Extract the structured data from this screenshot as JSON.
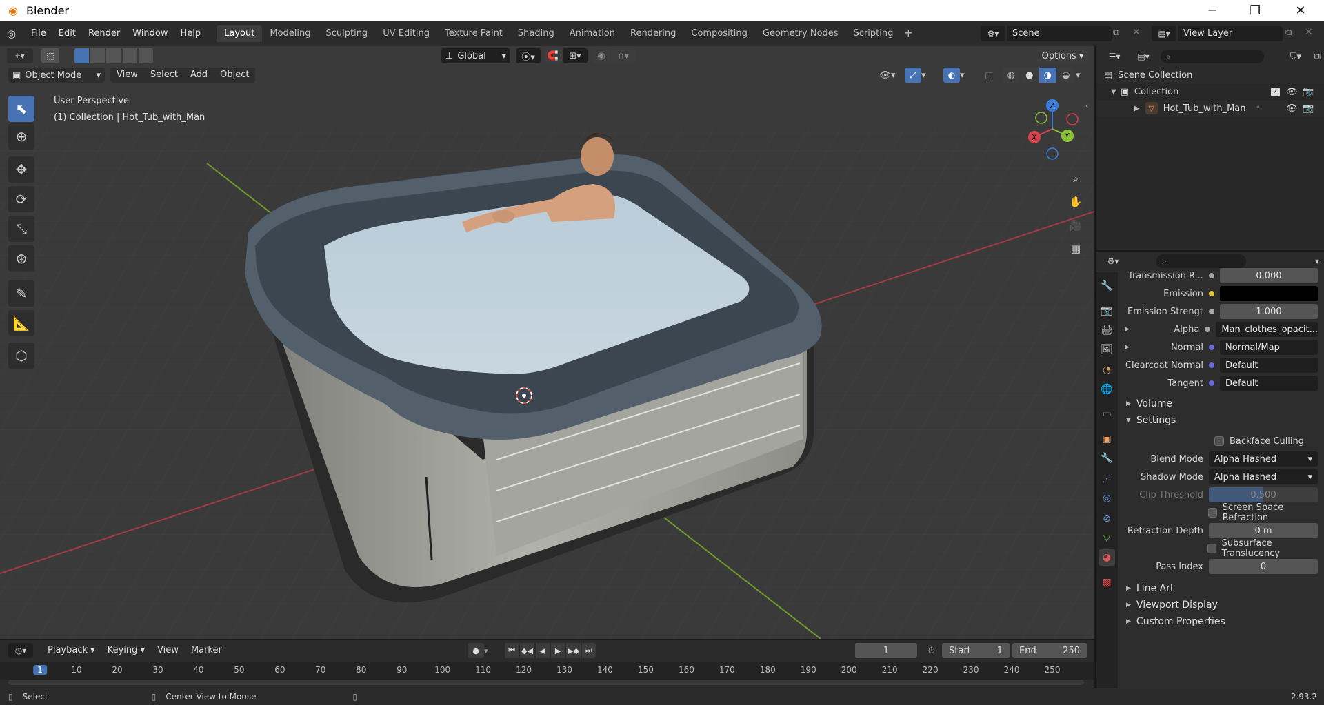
{
  "window": {
    "title": "Blender",
    "minimize": "─",
    "maximize": "❐",
    "close": "✕"
  },
  "menu": [
    "File",
    "Edit",
    "Render",
    "Window",
    "Help"
  ],
  "workspaces": [
    "Layout",
    "Modeling",
    "Sculpting",
    "UV Editing",
    "Texture Paint",
    "Shading",
    "Animation",
    "Rendering",
    "Compositing",
    "Geometry Nodes",
    "Scripting"
  ],
  "active_workspace": "Layout",
  "scene": {
    "name": "Scene",
    "view_layer": "View Layer"
  },
  "viewport": {
    "orientation": "Global",
    "options_label": "Options",
    "mode": "Object Mode",
    "header_menus": [
      "View",
      "Select",
      "Add",
      "Object"
    ],
    "perspective_label": "User Perspective",
    "collection_label": "(1) Collection | Hot_Tub_with_Man",
    "gizmo_axes": {
      "x": "X",
      "y": "Y",
      "z": "Z"
    }
  },
  "outliner": {
    "root": "Scene Collection",
    "collection": "Collection",
    "object": "Hot_Tub_with_Man"
  },
  "properties": {
    "rows": [
      {
        "label": "Transmission R...",
        "value": "0.000"
      },
      {
        "label": "Emission",
        "value": ""
      },
      {
        "label": "Emission Strengt",
        "value": "1.000"
      },
      {
        "label": "Alpha",
        "value": "Man_clothes_opacit..."
      },
      {
        "label": "Normal",
        "value": "Normal/Map"
      },
      {
        "label": "Clearcoat Normal",
        "value": "Default"
      },
      {
        "label": "Tangent",
        "value": "Default"
      }
    ],
    "sections": {
      "volume": "Volume",
      "settings": "Settings",
      "line_art": "Line Art",
      "viewport_display": "Viewport Display",
      "custom_properties": "Custom Properties"
    },
    "settings": {
      "backface_culling": "Backface Culling",
      "blend_mode_label": "Blend Mode",
      "blend_mode": "Alpha Hashed",
      "shadow_mode_label": "Shadow Mode",
      "shadow_mode": "Alpha Hashed",
      "clip_threshold_label": "Clip Threshold",
      "clip_threshold": "0.500",
      "screen_space_refraction": "Screen Space Refraction",
      "refraction_depth_label": "Refraction Depth",
      "refraction_depth": "0 m",
      "subsurface_translucency": "Subsurface Translucency",
      "pass_index_label": "Pass Index",
      "pass_index": "0"
    }
  },
  "timeline": {
    "menus": [
      "Playback",
      "Keying",
      "View",
      "Marker"
    ],
    "current_frame": "1",
    "start_label": "Start",
    "start": "1",
    "end_label": "End",
    "end": "250",
    "ruler": [
      "1",
      "10",
      "20",
      "30",
      "40",
      "50",
      "60",
      "70",
      "80",
      "90",
      "100",
      "110",
      "120",
      "130",
      "140",
      "150",
      "160",
      "170",
      "180",
      "190",
      "200",
      "210",
      "220",
      "230",
      "240",
      "250"
    ]
  },
  "statusbar": {
    "select": "Select",
    "center_view": "Center View to Mouse",
    "version": "2.93.2"
  },
  "colors": {
    "accent": "#4772b3",
    "x_axis": "#d4424e",
    "y_axis": "#8ac434",
    "z_axis": "#3a7ee0",
    "emission": "#000000"
  }
}
